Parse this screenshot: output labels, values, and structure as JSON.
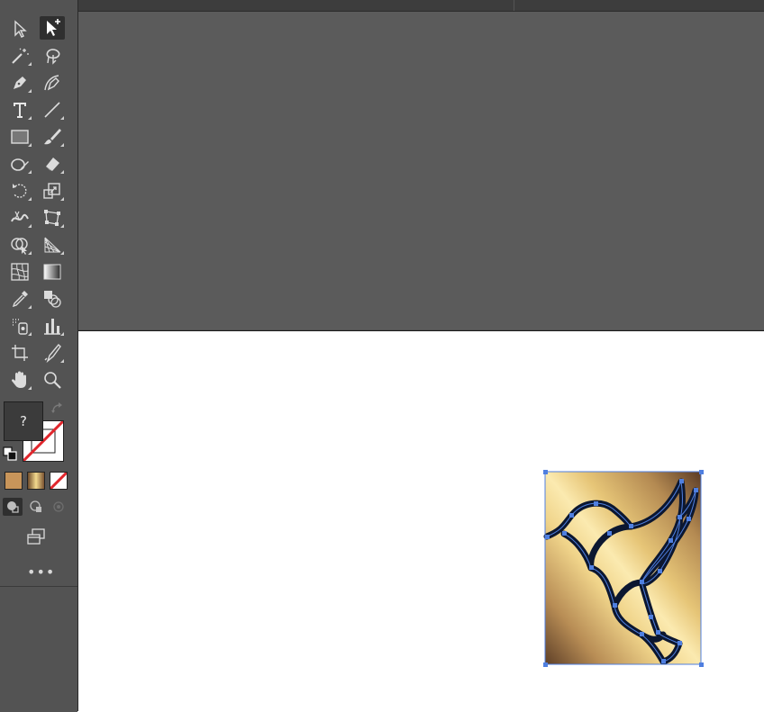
{
  "tools": [
    {
      "name": "selection-tool-icon"
    },
    {
      "name": "direct-selection-tool-icon"
    },
    {
      "name": "magic-wand-tool-icon"
    },
    {
      "name": "lasso-tool-icon"
    },
    {
      "name": "pen-tool-icon"
    },
    {
      "name": "curvature-tool-icon"
    },
    {
      "name": "type-tool-icon"
    },
    {
      "name": "line-segment-tool-icon"
    },
    {
      "name": "rectangle-tool-icon"
    },
    {
      "name": "paintbrush-tool-icon"
    },
    {
      "name": "shaper-tool-icon"
    },
    {
      "name": "eraser-tool-icon"
    },
    {
      "name": "rotate-tool-icon"
    },
    {
      "name": "scale-tool-icon"
    },
    {
      "name": "width-tool-icon"
    },
    {
      "name": "free-transform-tool-icon"
    },
    {
      "name": "shape-builder-tool-icon"
    },
    {
      "name": "perspective-grid-tool-icon"
    },
    {
      "name": "mesh-tool-icon"
    },
    {
      "name": "gradient-tool-icon"
    },
    {
      "name": "eyedropper-tool-icon"
    },
    {
      "name": "blend-tool-icon"
    },
    {
      "name": "symbol-sprayer-tool-icon"
    },
    {
      "name": "column-graph-tool-icon"
    },
    {
      "name": "artboard-tool-icon"
    },
    {
      "name": "slice-tool-icon"
    },
    {
      "name": "hand-tool-icon"
    },
    {
      "name": "zoom-tool-icon"
    }
  ],
  "fill_stroke": {
    "fill_label": "?",
    "more_label": "•••"
  },
  "colors": {
    "panel_bg": "#535353",
    "pasteboard": "#5b5b5b",
    "artboard": "#ffffff",
    "selection": "#4f7fe0",
    "gold_light": "#f2dc8f",
    "gold_dark": "#5e3f27",
    "stroke_none": "#e0262c"
  }
}
